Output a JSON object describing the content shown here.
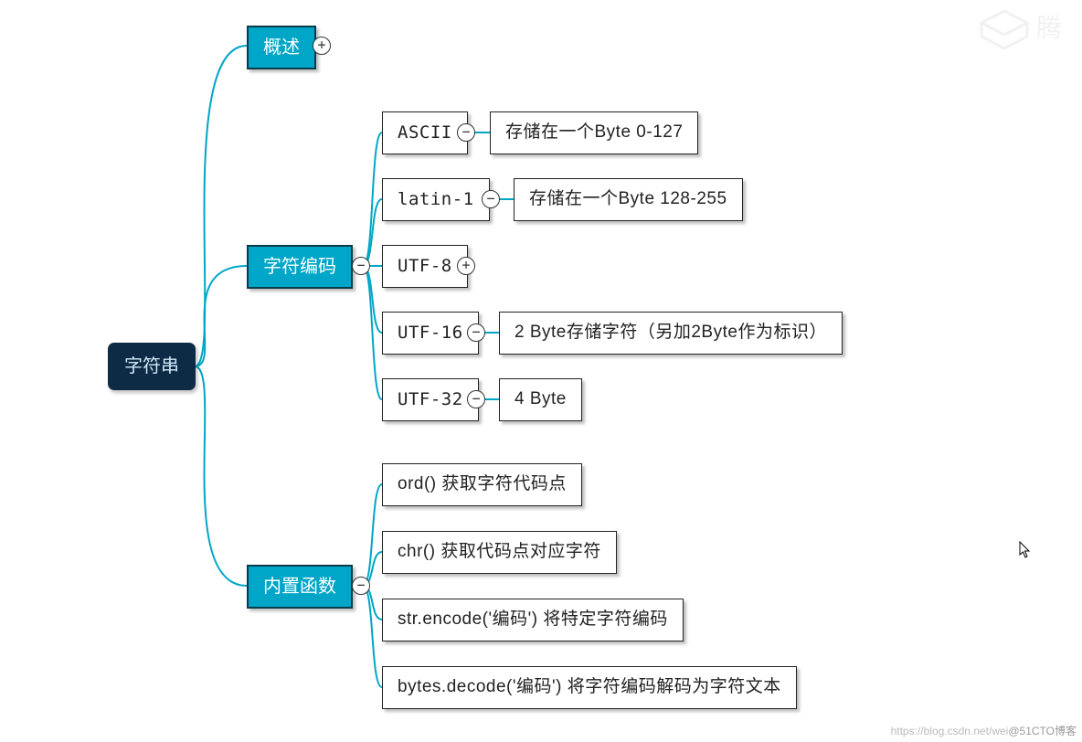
{
  "root": {
    "label": "字符串"
  },
  "branches": {
    "overview": {
      "label": "概述",
      "toggle": "+"
    },
    "encoding": {
      "label": "字符编码",
      "toggle": "−"
    },
    "builtins": {
      "label": "内置函数",
      "toggle": "−"
    }
  },
  "encoding": {
    "ascii": {
      "label": "ASCII",
      "toggle": "−",
      "desc": "存储在一个Byte  0-127"
    },
    "latin1": {
      "label": "latin-1",
      "toggle": "−",
      "desc": "存储在一个Byte 128-255"
    },
    "utf8": {
      "label": "UTF-8",
      "toggle": "−",
      "expand": "+"
    },
    "utf16": {
      "label": "UTF-16",
      "toggle": "−",
      "desc": "2 Byte存储字符（另加2Byte作为标识）"
    },
    "utf32": {
      "label": "UTF-32",
      "toggle": "−",
      "desc": "4 Byte"
    }
  },
  "builtins": {
    "ord": {
      "label": "ord()  获取字符代码点"
    },
    "chr": {
      "label": "chr()  获取代码点对应字符"
    },
    "enc": {
      "label": "str.encode('编码')  将特定字符编码"
    },
    "dec": {
      "label": "bytes.decode('编码')  将字符编码解码为字符文本"
    }
  },
  "watermark": {
    "text_prefix": "https://blog.csdn.net/wei",
    "text_suffix": "@51CTO博客",
    "brand": "腾"
  }
}
